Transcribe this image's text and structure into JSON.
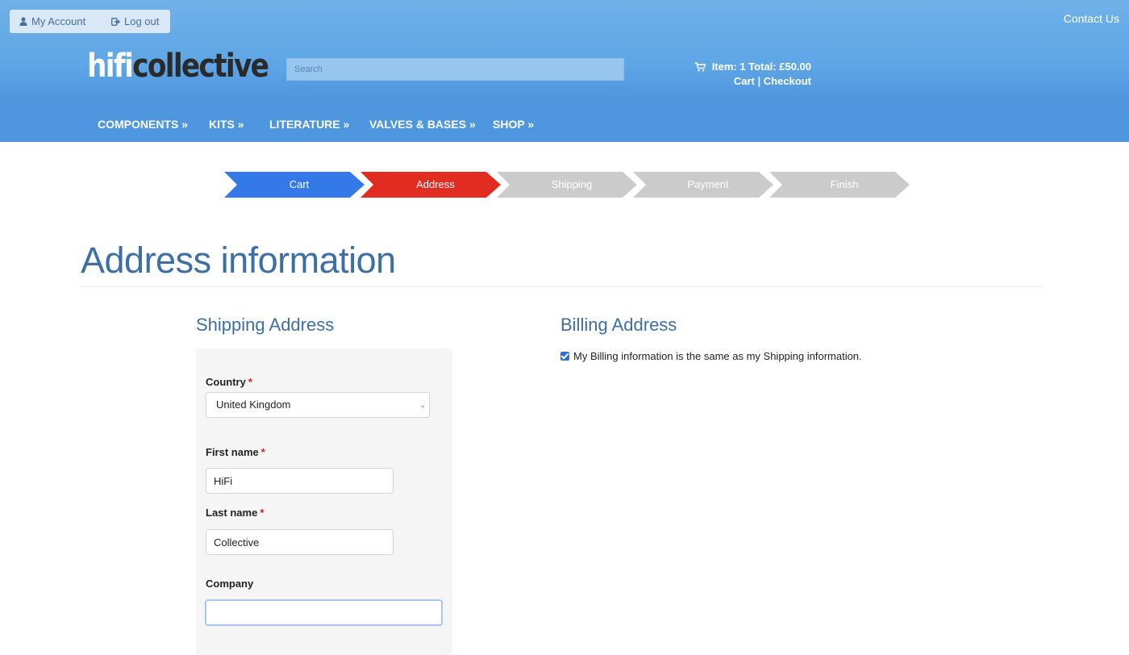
{
  "topbar": {
    "my_account": "My Account",
    "log_out": "Log out",
    "contact_us": "Contact Us"
  },
  "logo": {
    "part1": "hifi",
    "part2": "collective"
  },
  "search": {
    "placeholder": "Search",
    "value": ""
  },
  "cart": {
    "summary": "Item: 1 Total: £50.00",
    "cart_link": "Cart",
    "separator": " | ",
    "checkout_link": "Checkout"
  },
  "nav": {
    "items": [
      {
        "label": "COMPONENTS »"
      },
      {
        "label": "KITS »"
      },
      {
        "label": "LITERATURE »"
      },
      {
        "label": "VALVES & BASES »"
      },
      {
        "label": "SHOP »"
      }
    ]
  },
  "steps": {
    "items": [
      {
        "label": "Cart",
        "color": "#3479e8"
      },
      {
        "label": "Address",
        "color": "#e32c21"
      },
      {
        "label": "Shipping",
        "color": "#cbcbcb"
      },
      {
        "label": "Payment",
        "color": "#cbcbcb"
      },
      {
        "label": "Finish",
        "color": "#cbcbcb"
      }
    ],
    "active": "Address"
  },
  "page": {
    "title": "Address information"
  },
  "shipping": {
    "title": "Shipping Address",
    "country_label": "Country",
    "country_value": "United Kingdom",
    "first_name_label": "First name",
    "first_name_value": "HiFi",
    "last_name_label": "Last name",
    "last_name_value": "Collective",
    "company_label": "Company",
    "company_value": "",
    "required_marker": "*"
  },
  "billing": {
    "title": "Billing Address",
    "same_as_shipping_label": "My Billing information is the same as my Shipping information.",
    "same_as_shipping_checked": true
  },
  "colors": {
    "header_blue": "#5ea6e6",
    "title_blue": "#3d6ea5",
    "required_red": "#d21f1f"
  }
}
